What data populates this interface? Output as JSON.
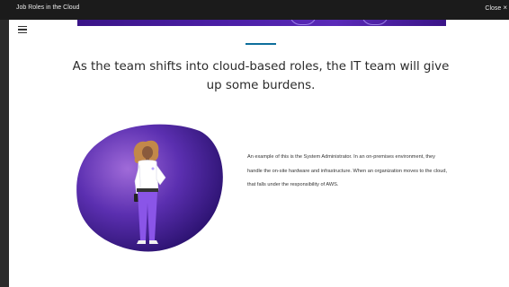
{
  "window": {
    "title": "Job Roles in the Cloud",
    "close_label": "Close",
    "close_glyph": "×"
  },
  "lesson": {
    "heading": "As the team shifts into cloud-based roles, the IT team will give up some burdens.",
    "body": "An example of this is the System Administrator. In an on-premises environment, they handle the on-site hardware and infrastructure. When an organization moves to the cloud, that falls under the responsibility of AWS."
  },
  "icons": {
    "menu": "hamburger-menu-icon",
    "close": "close-icon"
  },
  "colors": {
    "titlebar": "#1b1b1b",
    "accent_line": "#0d6e9c",
    "blob_dark": "#1e0a5e",
    "blob_mid": "#5b2fb0",
    "blob_light": "#a06bd9",
    "shirt": "#ffffff",
    "pants": "#8a55e8",
    "hair": "#c2884a"
  }
}
